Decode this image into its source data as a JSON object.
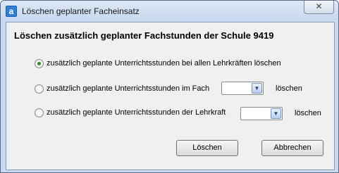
{
  "window": {
    "title": "Löschen geplanter Facheinsatz",
    "app_icon_letter": "a",
    "close_symbol": "✕"
  },
  "dialog": {
    "heading": "Löschen zusätzlich geplanter Fachstunden der Schule 9419",
    "options": [
      {
        "label": "zusätzlich geplante Unterrichtsstunden bei allen Lehrkräften löschen",
        "selected": true
      },
      {
        "label": "zusätzlich geplante Unterrichtsstunden im Fach",
        "selected": false,
        "select_value": "",
        "after_label": "löschen"
      },
      {
        "label": "zusätzlich geplante Unterrichtsstunden der Lehrkraft",
        "selected": false,
        "select_value": "",
        "after_label": "löschen"
      }
    ],
    "buttons": {
      "delete": "Löschen",
      "cancel": "Abbrechen"
    }
  }
}
